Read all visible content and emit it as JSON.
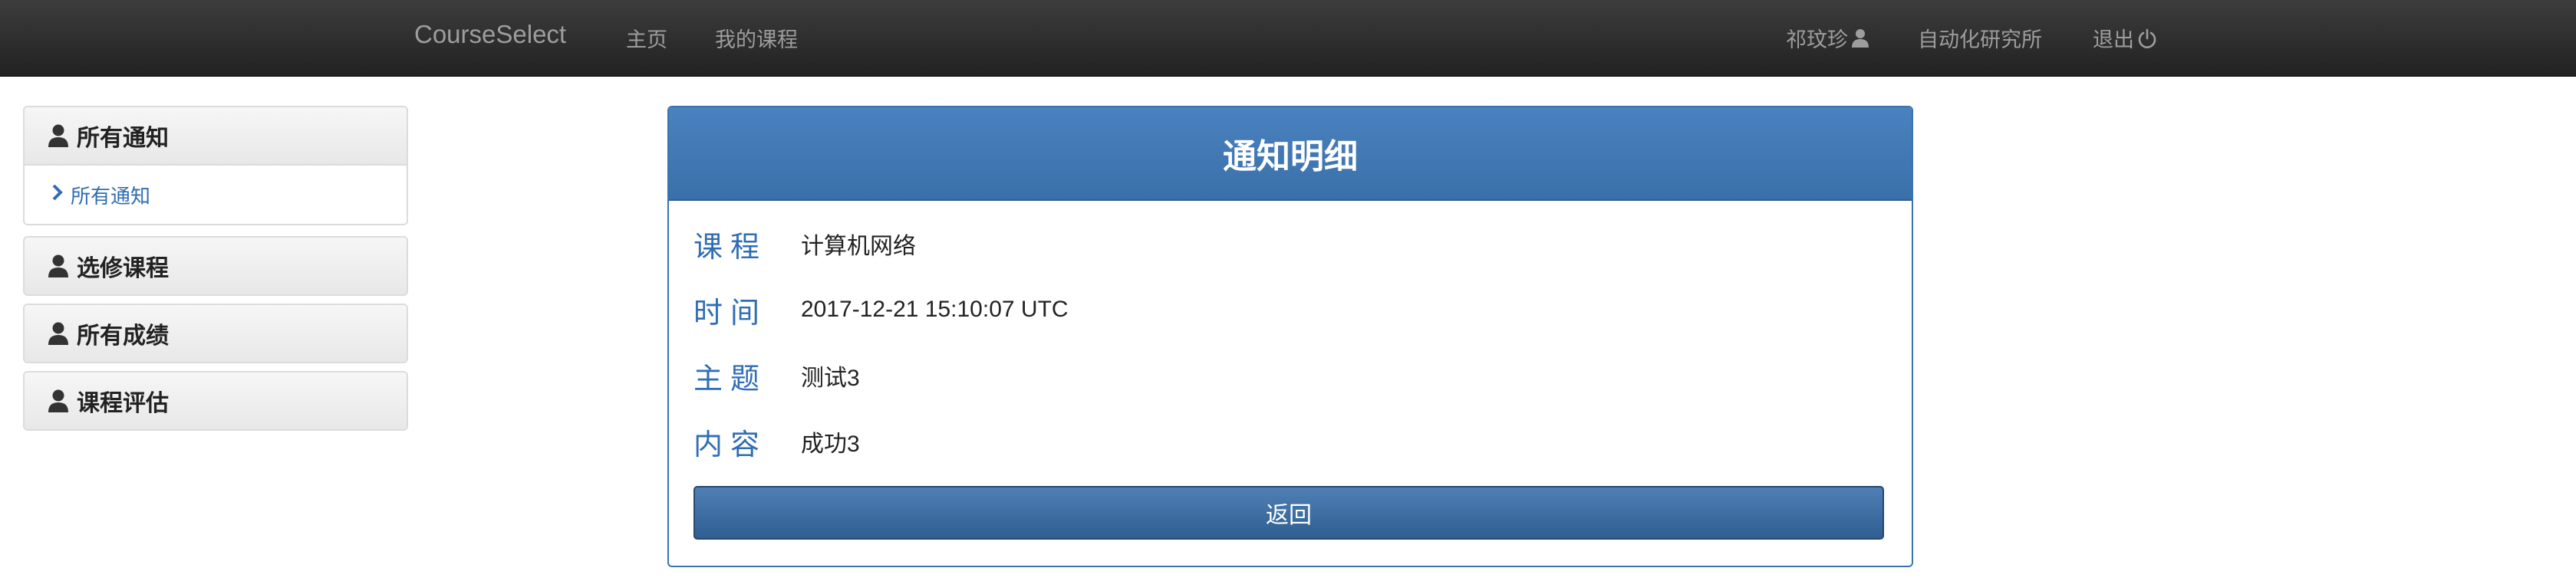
{
  "navbar": {
    "brand": "CourseSelect",
    "home": "主页",
    "my_courses": "我的课程",
    "user": "祁玟珍",
    "institute": "自动化研究所",
    "logout": "退出"
  },
  "sidebar": {
    "notices": {
      "title": "所有通知",
      "sub_item": "所有通知"
    },
    "elective": {
      "title": "选修课程"
    },
    "grades": {
      "title": "所有成绩"
    },
    "evaluation": {
      "title": "课程评估"
    }
  },
  "notice": {
    "title": "通知明细",
    "fields": {
      "course": {
        "label": "课程",
        "value": "计算机网络"
      },
      "time": {
        "label": "时间",
        "value": "2017-12-21 15:10:07 UTC"
      },
      "subject": {
        "label": "主题",
        "value": "测试3"
      },
      "content": {
        "label": "内容",
        "value": "成功3"
      }
    },
    "back_button": "返回"
  },
  "colors": {
    "navbar_bg": "#2a2a2a",
    "accent": "#3a70aa",
    "link": "#2f6db5"
  }
}
